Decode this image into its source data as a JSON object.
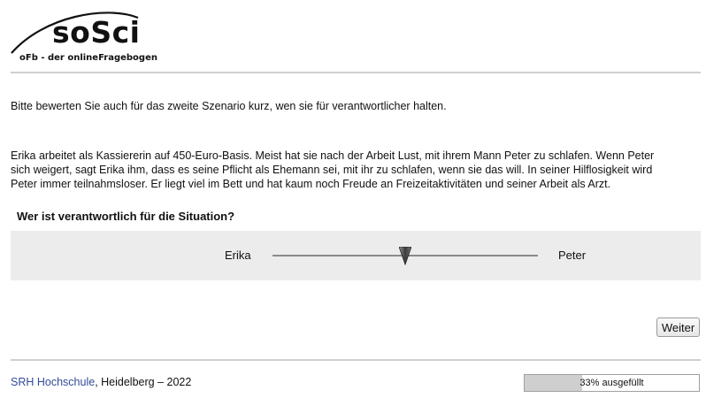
{
  "logo": {
    "name": "soSci",
    "tagline": "oFb - der onlineFragebogen"
  },
  "intro": "Bitte bewerten Sie auch für das zweite Szenario kurz, wen sie für verantwortlicher halten.",
  "scenario": {
    "line1": "Erika arbeitet als Kassiererin auf 450-Euro-Basis. Meist hat sie nach der Arbeit Lust, mit ihrem Mann Peter zu schlafen. Wenn Peter",
    "line2": "sich weigert, sagt Erika ihm, dass es seine Pflicht als Ehemann sei, mit ihr zu schlafen, wenn sie das will. In seiner Hilflosigkeit wird",
    "line3": "Peter immer teilnahmsloser. Er liegt viel im Bett und hat kaum noch Freude an Freizeitaktivitäten und seiner Arbeit als Arzt."
  },
  "question": "Wer ist verantwortlich für die Situation?",
  "slider": {
    "left_label": "Erika",
    "right_label": "Peter",
    "value_fraction": 0.5,
    "thumb_icon": "down-triangle-handle"
  },
  "next_button": "Weiter",
  "footer": {
    "link": "SRH Hochschule",
    "text": ", Heidelberg – 2022"
  },
  "progress": {
    "percent": 33,
    "label": "33% ausgefüllt"
  },
  "colors": {
    "panel_bg": "#ececec",
    "link": "#334a99",
    "progress_fill": "#cfcfcf"
  }
}
